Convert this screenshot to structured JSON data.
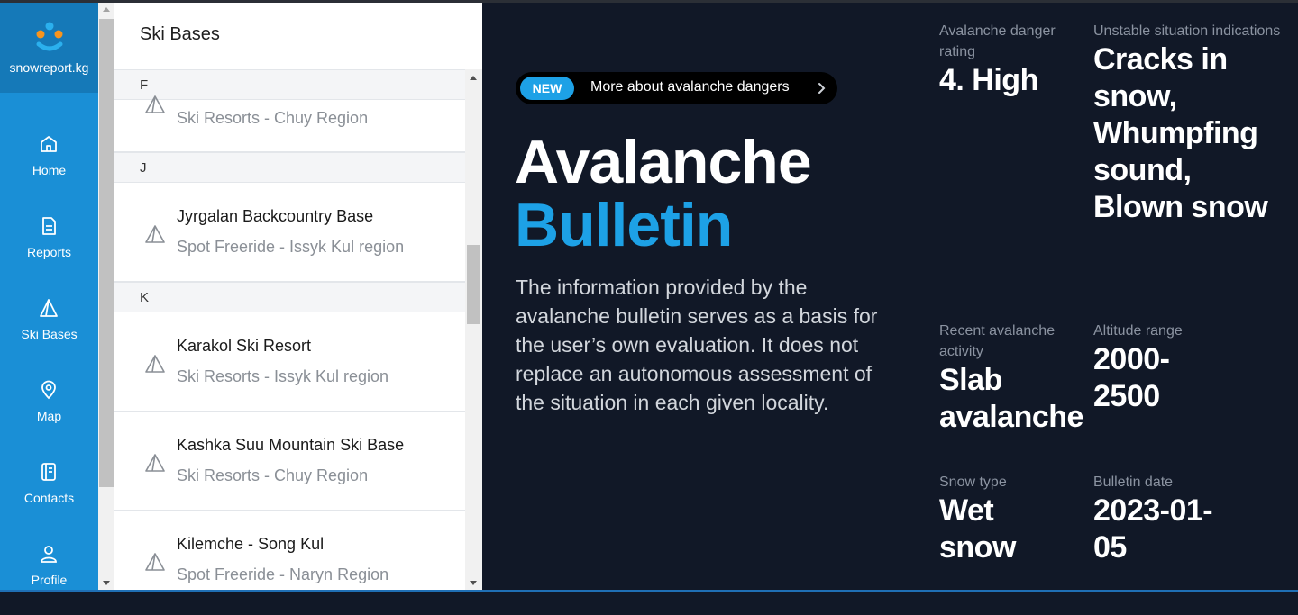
{
  "brand": {
    "name": "snowreport.kg"
  },
  "nav": [
    {
      "label": "Home",
      "icon": "home-icon"
    },
    {
      "label": "Reports",
      "icon": "document-icon"
    },
    {
      "label": "Ski Bases",
      "icon": "mountain-icon"
    },
    {
      "label": "Map",
      "icon": "map-pin-icon"
    },
    {
      "label": "Contacts",
      "icon": "contacts-book-icon"
    },
    {
      "label": "Profile",
      "icon": "user-icon"
    }
  ],
  "panel": {
    "title": "Ski Bases",
    "groups": [
      {
        "letter": "F",
        "items": [
          {
            "name": "",
            "sub": "Ski Resorts - Chuy Region"
          }
        ]
      },
      {
        "letter": "J",
        "items": [
          {
            "name": "Jyrgalan Backcountry Base",
            "sub": "Spot Freeride - Issyk Kul region"
          }
        ]
      },
      {
        "letter": "K",
        "items": [
          {
            "name": "Karakol Ski Resort",
            "sub": "Ski Resorts - Issyk Kul region"
          },
          {
            "name": "Kashka Suu Mountain Ski Base",
            "sub": "Ski Resorts - Chuy Region"
          },
          {
            "name": "Kilemche - Song Kul",
            "sub": "Spot Freeride - Naryn Region"
          }
        ]
      }
    ]
  },
  "hero": {
    "badge": "NEW",
    "link_text": "More about avalanche dangers",
    "title_line1": "Avalanche",
    "title_line2": "Bulletin",
    "description": "The information provided by the avalanche bulletin serves as a basis for the user’s own evaluation. It does not replace an autonomous assessment of the situation in each given locality."
  },
  "stats": {
    "danger": {
      "label": "Avalanche danger rating",
      "value": "4. High"
    },
    "unstable": {
      "label": "Unstable situation indications",
      "value": "Cracks in snow, Whumpfing sound, Blown snow"
    },
    "activity": {
      "label": "Recent avalanche activity",
      "value": "Slab avalanche"
    },
    "altitude": {
      "label": "Altitude range",
      "value": "2000-2500"
    },
    "snow_type": {
      "label": "Snow type",
      "value": "Wet snow"
    },
    "date": {
      "label": "Bulletin date",
      "value": "2023-01-05"
    }
  },
  "colors": {
    "accent": "#1da1e6",
    "sidebar": "#1a8fd6",
    "hero_bg": "#111827"
  }
}
